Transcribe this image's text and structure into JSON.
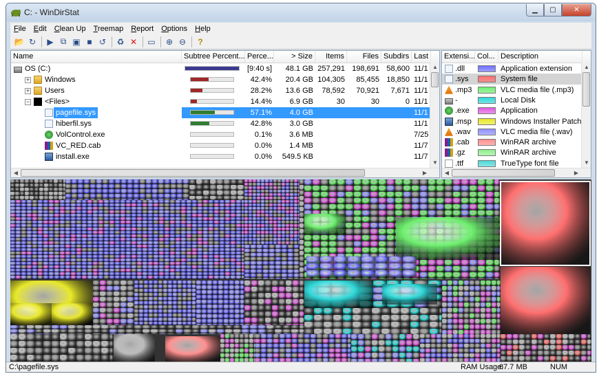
{
  "window": {
    "title": "C: - WinDirStat"
  },
  "menu": [
    {
      "pre": "",
      "acc": "F",
      "post": "ile"
    },
    {
      "pre": "",
      "acc": "E",
      "post": "dit"
    },
    {
      "pre": "",
      "acc": "C",
      "post": "lean Up"
    },
    {
      "pre": "",
      "acc": "T",
      "post": "reemap"
    },
    {
      "pre": "",
      "acc": "R",
      "post": "eport"
    },
    {
      "pre": "",
      "acc": "O",
      "post": "ptions"
    },
    {
      "pre": "",
      "acc": "H",
      "post": "elp"
    }
  ],
  "toolbar": [
    {
      "name": "open-icon",
      "glyph": "📂"
    },
    {
      "name": "refresh-icon",
      "glyph": "↻"
    },
    {
      "sep": true
    },
    {
      "name": "play-icon",
      "glyph": "▶"
    },
    {
      "name": "copy-path-icon",
      "glyph": "⧉"
    },
    {
      "name": "explorer-icon",
      "glyph": "▣"
    },
    {
      "name": "command-prompt-icon",
      "glyph": "■"
    },
    {
      "name": "refresh-selected-icon",
      "glyph": "↺"
    },
    {
      "sep": true
    },
    {
      "name": "recycle-icon",
      "glyph": "♻"
    },
    {
      "name": "delete-icon",
      "glyph": "✕",
      "color": "#d11"
    },
    {
      "sep": true
    },
    {
      "name": "properties-icon",
      "glyph": "▭"
    },
    {
      "sep": true
    },
    {
      "name": "zoom-in-icon",
      "glyph": "⊕"
    },
    {
      "name": "zoom-out-icon",
      "glyph": "⊖"
    },
    {
      "sep": true
    },
    {
      "name": "help-icon",
      "glyph": "?",
      "color": "#b58900"
    }
  ],
  "tree": {
    "columns": [
      "Name",
      "Subtree Percent...",
      "Perce...",
      "> Size",
      "Items",
      "Files",
      "Subdirs",
      "Last"
    ],
    "rows": [
      {
        "name": "OS (C:)",
        "level": 0,
        "icon": "drive",
        "twisty": "",
        "bar": 1.0,
        "barColor": "#3a3a90",
        "pct": "[9:40 s]",
        "size": "48.1 GB",
        "items": "257,291",
        "files": "198,691",
        "subdirs": "58,600",
        "last": "11/1"
      },
      {
        "name": "Windows",
        "level": 1,
        "icon": "folder",
        "twisty": "+",
        "bar": 0.424,
        "barColor": "#a02828",
        "pct": "42.4%",
        "size": "20.4 GB",
        "items": "104,305",
        "files": "85,455",
        "subdirs": "18,850",
        "last": "11/1"
      },
      {
        "name": "Users",
        "level": 1,
        "icon": "folder",
        "twisty": "+",
        "bar": 0.282,
        "barColor": "#a02828",
        "pct": "28.2%",
        "size": "13.6 GB",
        "items": "78,592",
        "files": "70,921",
        "subdirs": "7,671",
        "last": "11/1"
      },
      {
        "name": "<Files>",
        "level": 1,
        "icon": "black",
        "twisty": "−",
        "bar": 0.144,
        "barColor": "#a02828",
        "pct": "14.4%",
        "size": "6.9 GB",
        "items": "30",
        "files": "30",
        "subdirs": "0",
        "last": "11/1"
      },
      {
        "name": "pagefile.sys",
        "level": 2,
        "icon": "sys",
        "twisty": "",
        "bar": 0.571,
        "barColor": "#2e7d32",
        "pct": "57.1%",
        "size": "4.0 GB",
        "items": "",
        "files": "",
        "subdirs": "",
        "last": "11/1",
        "selected": true
      },
      {
        "name": "hiberfil.sys",
        "level": 2,
        "icon": "sys",
        "twisty": "",
        "bar": 0.428,
        "barColor": "#2e7d32",
        "pct": "42.8%",
        "size": "3.0 GB",
        "items": "",
        "files": "",
        "subdirs": "",
        "last": "11/1"
      },
      {
        "name": "VolControl.exe",
        "level": 2,
        "icon": "exe",
        "twisty": "",
        "bar": 0.001,
        "barColor": "#2e7d32",
        "pct": "0.1%",
        "size": "3.6 MB",
        "items": "",
        "files": "",
        "subdirs": "",
        "last": "7/25"
      },
      {
        "name": "VC_RED.cab",
        "level": 2,
        "icon": "cab",
        "twisty": "",
        "bar": 0.0,
        "barColor": "#2e7d32",
        "pct": "0.0%",
        "size": "1.4 MB",
        "items": "",
        "files": "",
        "subdirs": "",
        "last": "11/7"
      },
      {
        "name": "install.exe",
        "level": 2,
        "icon": "msi",
        "twisty": "",
        "bar": 0.0,
        "barColor": "#2e7d32",
        "pct": "0.0%",
        "size": "549.5 KB",
        "items": "",
        "files": "",
        "subdirs": "",
        "last": "11/7"
      }
    ]
  },
  "extensions": {
    "columns": [
      "Extensi...",
      "Col...",
      "Description"
    ],
    "rows": [
      {
        "ext": ".dll",
        "color": "#6f6fff",
        "desc": "Application extension",
        "icon": "dll"
      },
      {
        "ext": ".sys",
        "color": "#ff6f6f",
        "desc": "System file",
        "icon": "sys",
        "selected": true
      },
      {
        "ext": ".mp3",
        "color": "#6fef6f",
        "desc": "VLC media file (.mp3)",
        "icon": "vlc"
      },
      {
        "ext": "-",
        "color": "#2fd8d8",
        "desc": "Local Disk",
        "icon": "drive"
      },
      {
        "ext": ".exe",
        "color": "#e05ce0",
        "desc": "Application",
        "icon": "exe"
      },
      {
        "ext": ".msp",
        "color": "#e8e82a",
        "desc": "Windows Installer Patch",
        "icon": "msi"
      },
      {
        "ext": ".wav",
        "color": "#8f8fff",
        "desc": "VLC media file (.wav)",
        "icon": "vlc"
      },
      {
        "ext": ".cab",
        "color": "#ff8f8f",
        "desc": "WinRAR archive",
        "icon": "cab"
      },
      {
        "ext": ".gz",
        "color": "#8fef8f",
        "desc": "WinRAR archive",
        "icon": "cab"
      },
      {
        "ext": ".ttf",
        "color": "#4fd8d8",
        "desc": "TrueType font file",
        "icon": "font"
      }
    ]
  },
  "status": {
    "path": "C:\\pagefile.sys",
    "ram_label": "RAM Usage:",
    "ram_value": "67.7 MB",
    "num": "NUM"
  },
  "colors": {
    "selection": "#3399ff",
    "treemap_highlight": "#ffffff"
  }
}
